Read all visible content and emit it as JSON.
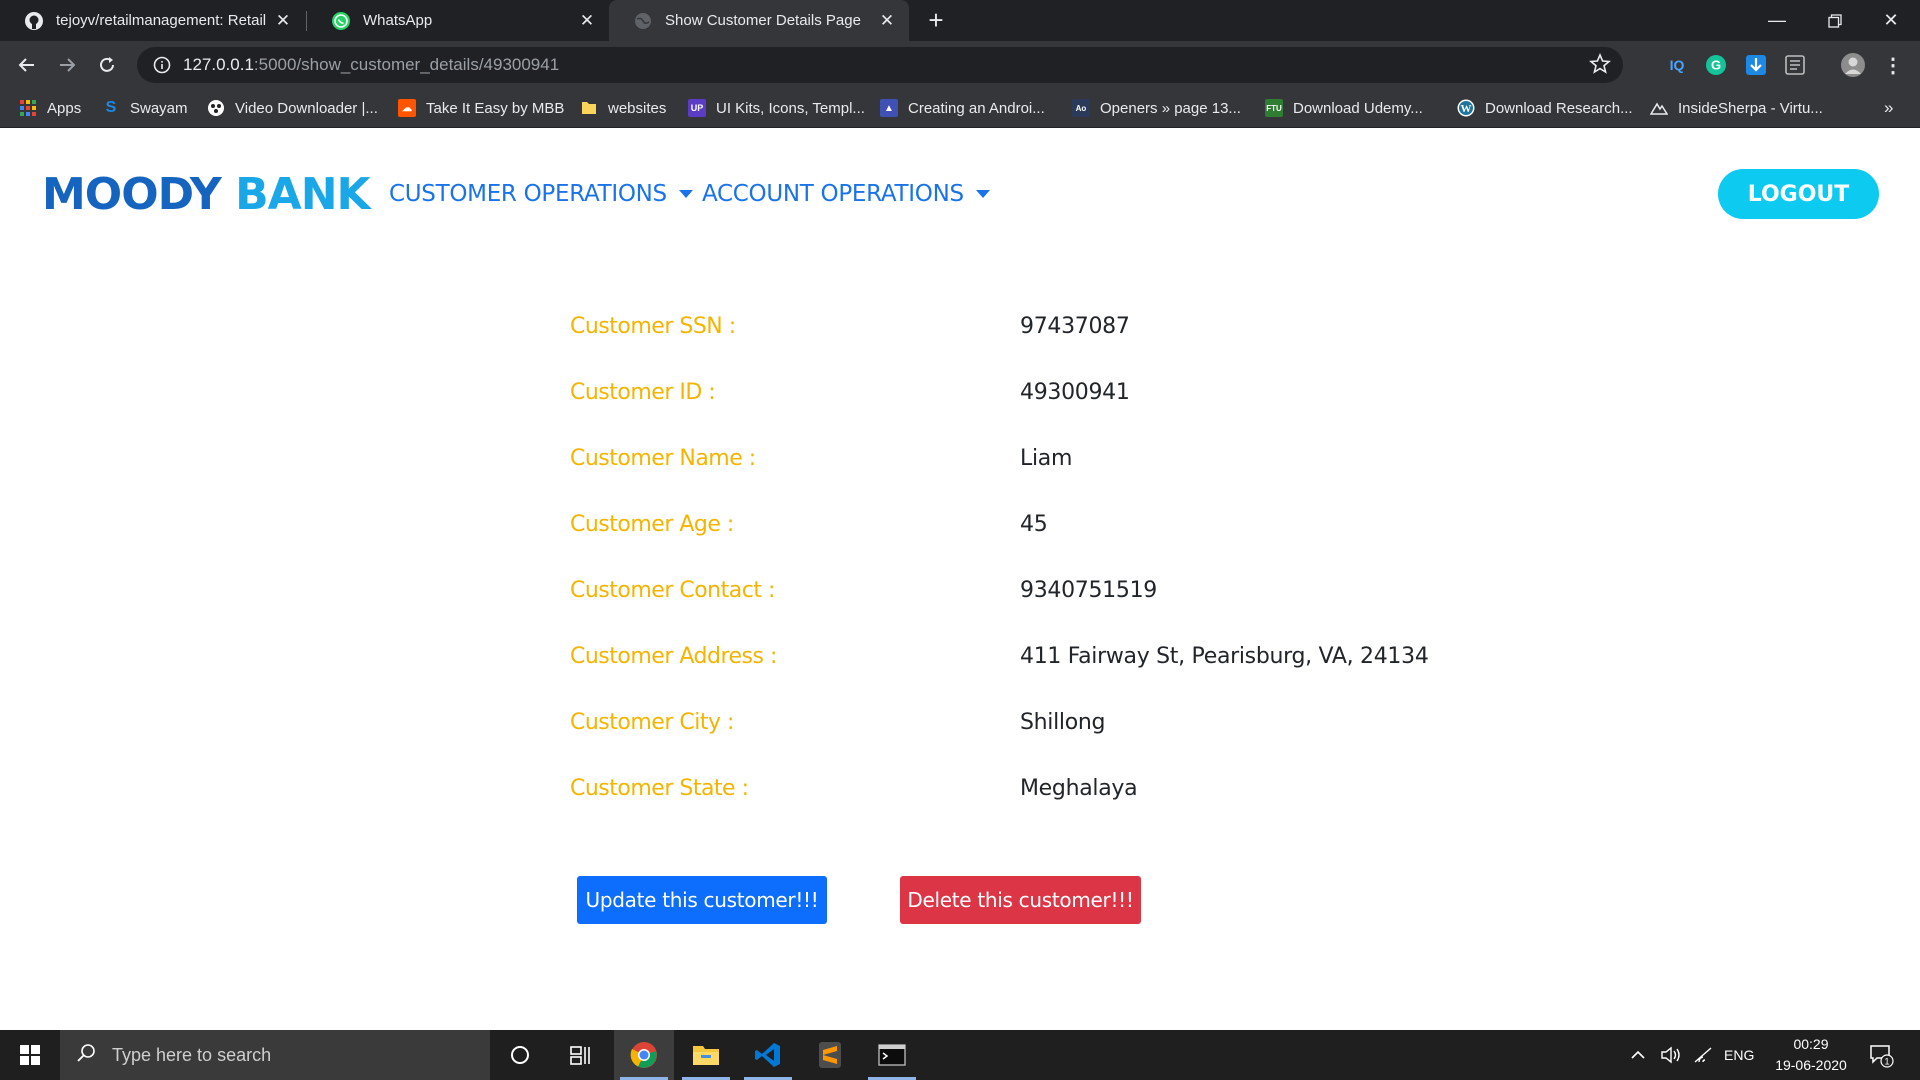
{
  "browser": {
    "tabs": [
      {
        "title": "tejoyv/retailmanagement: Retail M",
        "icon": "github-icon"
      },
      {
        "title": "WhatsApp",
        "icon": "whatsapp-icon"
      },
      {
        "title": "Show Customer Details Page",
        "icon": "globe-icon",
        "active": true
      }
    ],
    "url_host": "127.0.0.1",
    "url_path": ":5000/show_customer_details/49300941",
    "bookmarks": [
      {
        "label": "Apps"
      },
      {
        "label": "Swayam"
      },
      {
        "label": "Video Downloader |..."
      },
      {
        "label": "Take It Easy by MBB"
      },
      {
        "label": "websites"
      },
      {
        "label": "UI Kits, Icons, Templ..."
      },
      {
        "label": "Creating an Androi..."
      },
      {
        "label": "Openers » page 13..."
      },
      {
        "label": "Download Udemy..."
      },
      {
        "label": "Download Research..."
      },
      {
        "label": "InsideSherpa - Virtu..."
      }
    ],
    "bookmarks_overflow": "»"
  },
  "navbar": {
    "brand_part1": "MOODY",
    "brand_part2": "BANK",
    "menu1": "CUSTOMER OPERATIONS",
    "menu2": "ACCOUNT OPERATIONS",
    "logout": "LOGOUT"
  },
  "customer": {
    "rows": [
      {
        "label": "Customer SSN :",
        "value": "97437087"
      },
      {
        "label": "Customer ID :",
        "value": "49300941"
      },
      {
        "label": "Customer Name :",
        "value": "Liam"
      },
      {
        "label": "Customer Age :",
        "value": "45"
      },
      {
        "label": "Customer Contact :",
        "value": "9340751519"
      },
      {
        "label": "Customer Address :",
        "value": "411 Fairway St, Pearisburg, VA, 24134"
      },
      {
        "label": "Customer City :",
        "value": "Shillong"
      },
      {
        "label": "Customer State :",
        "value": "Meghalaya"
      }
    ],
    "update_button": "Update this customer!!!",
    "delete_button": "Delete this customer!!!"
  },
  "taskbar": {
    "search_placeholder": "Type here to search",
    "language": "ENG",
    "time": "00:29",
    "date": "19-06-2020",
    "notification_count": "1"
  },
  "colors": {
    "label": "#f4b400",
    "brand_dark": "#1565c0",
    "brand_light": "#1aa7e8",
    "nav_link": "#1a73e8",
    "logout_bg": "#0dcaf0",
    "update_bg": "#0d6efd",
    "delete_bg": "#dc3545"
  }
}
